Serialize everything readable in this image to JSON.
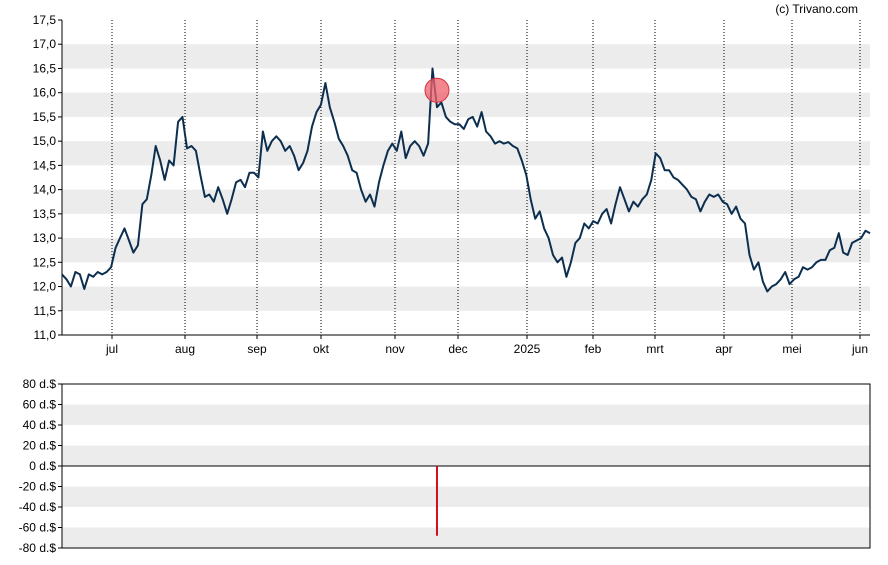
{
  "credit": "(c) Trivano.com",
  "colors": {
    "background": "#ffffff",
    "band": "#ececec",
    "price_line": "#0d2f4f",
    "marker_fill": "#ef5f6a",
    "dividend_bar": "#d0101e",
    "axis": "#000000"
  },
  "chart_data": [
    {
      "type": "line",
      "ylim": [
        11.0,
        17.5
      ],
      "yticks": [
        "11,0",
        "11,5",
        "12,0",
        "12,5",
        "13,0",
        "13,5",
        "14,0",
        "14,5",
        "15,0",
        "15,5",
        "16,0",
        "16,5",
        "17,0",
        "17,5"
      ],
      "xticks": [
        "jul",
        "aug",
        "sep",
        "okt",
        "nov",
        "dec",
        "2025",
        "feb",
        "mrt",
        "apr",
        "mei",
        "jun"
      ],
      "series": [
        {
          "values": [
            12.25,
            12.15,
            12.0,
            12.3,
            12.25,
            11.95,
            12.25,
            12.2,
            12.3,
            12.25,
            12.3,
            12.4,
            12.8,
            13.0,
            13.2,
            12.95,
            12.7,
            12.85,
            13.7,
            13.8,
            14.3,
            14.9,
            14.6,
            14.2,
            14.6,
            14.5,
            15.4,
            15.5,
            14.85,
            14.9,
            14.8,
            14.3,
            13.85,
            13.9,
            13.75,
            14.05,
            13.8,
            13.5,
            13.8,
            14.15,
            14.2,
            14.05,
            14.35,
            14.35,
            14.25,
            15.2,
            14.8,
            15.0,
            15.1,
            15.0,
            14.8,
            14.9,
            14.7,
            14.4,
            14.55,
            14.8,
            15.3,
            15.6,
            15.75,
            16.2,
            15.7,
            15.4,
            15.05,
            14.9,
            14.7,
            14.4,
            14.35,
            14.0,
            13.75,
            13.9,
            13.65,
            14.15,
            14.5,
            14.8,
            14.95,
            14.8,
            15.2,
            14.65,
            14.9,
            15.0,
            14.9,
            14.7,
            14.95,
            16.5,
            15.7,
            15.8,
            15.5,
            15.4,
            15.35,
            15.35,
            15.25,
            15.45,
            15.5,
            15.3,
            15.6,
            15.2,
            15.1,
            14.95,
            15.0,
            14.95,
            14.98,
            14.9,
            14.85,
            14.6,
            14.3,
            13.8,
            13.4,
            13.55,
            13.2,
            13.0,
            12.65,
            12.5,
            12.6,
            12.2,
            12.5,
            12.9,
            13.0,
            13.3,
            13.2,
            13.35,
            13.3,
            13.5,
            13.6,
            13.3,
            13.7,
            14.05,
            13.8,
            13.55,
            13.75,
            13.65,
            13.8,
            13.9,
            14.2,
            14.75,
            14.65,
            14.4,
            14.4,
            14.25,
            14.2,
            14.1,
            14.0,
            13.85,
            13.8,
            13.55,
            13.75,
            13.9,
            13.85,
            13.9,
            13.75,
            13.7,
            13.5,
            13.65,
            13.4,
            13.3,
            12.65,
            12.35,
            12.5,
            12.1,
            11.9,
            12.0,
            12.05,
            12.15,
            12.3,
            12.05,
            12.15,
            12.2,
            12.4,
            12.35,
            12.4,
            12.5,
            12.55,
            12.55,
            12.75,
            12.8,
            13.1,
            12.7,
            12.65,
            12.9,
            12.95,
            13.0,
            13.15,
            13.1
          ]
        }
      ],
      "marker": {
        "x_index": 84,
        "y": 16.05
      }
    },
    {
      "type": "bar",
      "ylim": [
        -80,
        80
      ],
      "yticks": [
        "80 d.$",
        "60 d.$",
        "40 d.$",
        "20 d.$",
        "0 d.$",
        "-20 d.$",
        "-40 d.$",
        "-60 d.$",
        "-80 d.$"
      ],
      "series": [
        {
          "values": [
            {
              "x_index": 84,
              "y": -68
            }
          ]
        }
      ]
    }
  ]
}
